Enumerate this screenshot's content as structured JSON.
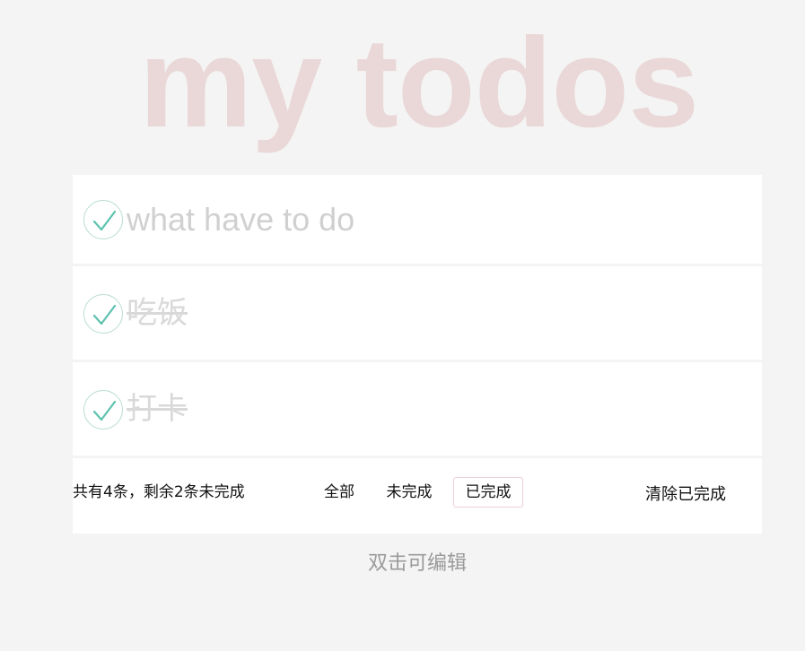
{
  "app": {
    "title": "my todos",
    "hint": "双击可编辑"
  },
  "new_todo": {
    "placeholder": "what have to do",
    "value": ""
  },
  "todos": [
    {
      "label": "吃饭",
      "completed": true
    },
    {
      "label": "打卡",
      "completed": true
    }
  ],
  "footer": {
    "count_text": "共有4条，剩余2条未完成",
    "filters": [
      {
        "label": "全部",
        "selected": false
      },
      {
        "label": "未完成",
        "selected": false
      },
      {
        "label": "已完成",
        "selected": true
      }
    ],
    "clear_label": "清除已完成"
  },
  "colors": {
    "background": "#f4f4f4",
    "title": "#ead7d7",
    "check": "#5dc2af",
    "check_ring": "#b9ddd3",
    "selected_filter_border": "#ead0d3",
    "completed_text": "#d9d9d9"
  },
  "icons": {
    "toggle": "check-circle-icon"
  }
}
